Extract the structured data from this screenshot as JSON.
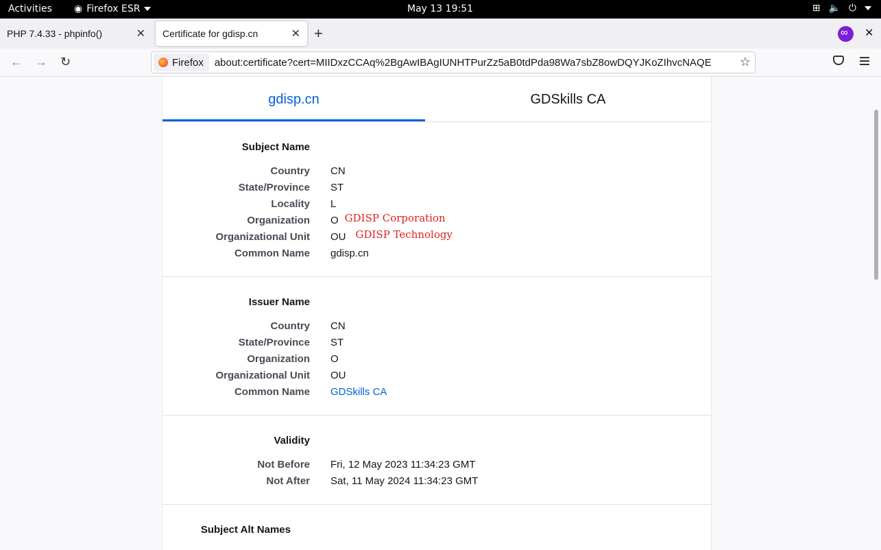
{
  "system_bar": {
    "activities": "Activities",
    "app_name": "Firefox ESR",
    "clock": "May 13  19:51"
  },
  "tabs": [
    {
      "title": "PHP 7.4.33 - phpinfo()",
      "active": false
    },
    {
      "title": "Certificate for gdisp.cn",
      "active": true
    }
  ],
  "toolbar": {
    "identity_label": "Firefox",
    "url": "about:certificate?cert=MIIDxzCCAq%2BgAwIBAgIUNHTPurZz5aB0tdPda98Wa7sbZ8owDQYJKoZIhvcNAQE"
  },
  "cert_tabs": [
    "gdisp.cn",
    "GDSkills CA"
  ],
  "subject": {
    "title": "Subject Name",
    "rows": [
      {
        "key": "Country",
        "value": "CN"
      },
      {
        "key": "State/Province",
        "value": "ST"
      },
      {
        "key": "Locality",
        "value": "L"
      },
      {
        "key": "Organization",
        "value": "O",
        "note": "GDISP Corporation"
      },
      {
        "key": "Organizational Unit",
        "value": "OU",
        "note": "GDISP Technology"
      },
      {
        "key": "Common Name",
        "value": "gdisp.cn"
      }
    ]
  },
  "issuer": {
    "title": "Issuer Name",
    "rows": [
      {
        "key": "Country",
        "value": "CN"
      },
      {
        "key": "State/Province",
        "value": "ST"
      },
      {
        "key": "Organization",
        "value": "O"
      },
      {
        "key": "Organizational Unit",
        "value": "OU"
      },
      {
        "key": "Common Name",
        "value": "GDSkills CA"
      }
    ]
  },
  "validity": {
    "title": "Validity",
    "rows": [
      {
        "key": "Not Before",
        "value": "Fri, 12 May 2023 11:34:23 GMT"
      },
      {
        "key": "Not After",
        "value": "Sat, 11 May 2024 11:34:23 GMT"
      }
    ]
  },
  "alt_names": {
    "title": "Subject Alt Names"
  },
  "colors": {
    "accent": "#0060df",
    "annotation": "#e02020"
  }
}
